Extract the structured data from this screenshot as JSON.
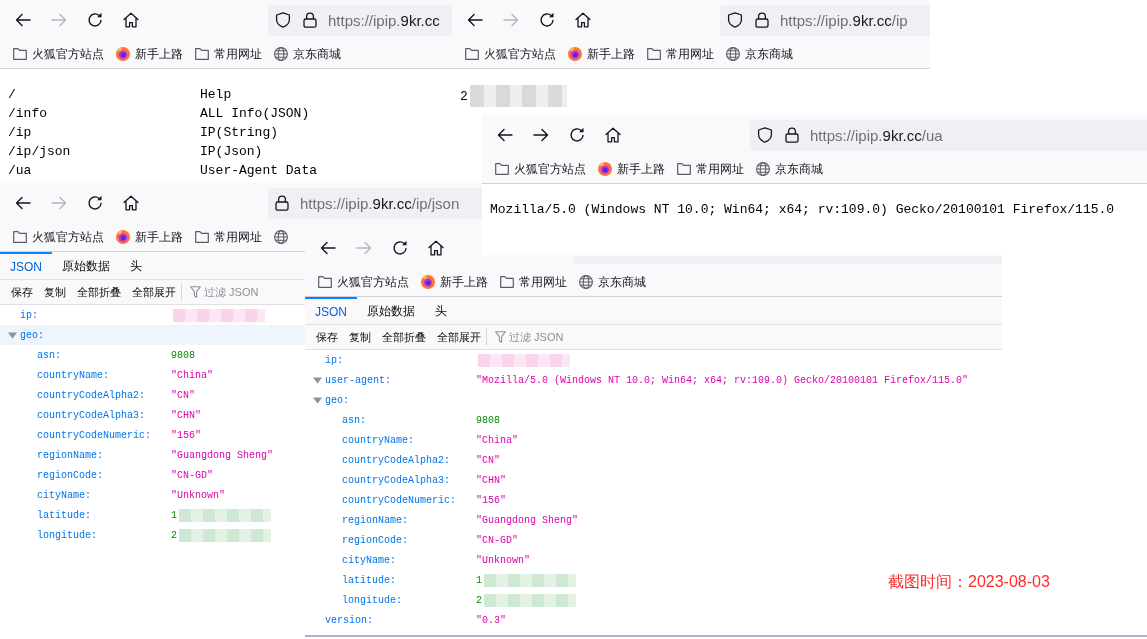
{
  "windows": [
    {
      "kind": "routes",
      "nav": {
        "forward_disabled": true
      },
      "url": {
        "origin": "https://ipip.",
        "domain": "9kr.cc",
        "shield": true
      },
      "bookmarks": [
        {
          "kind": "folder",
          "label": "火狐官方站点"
        },
        {
          "kind": "browser",
          "label": "新手上路"
        },
        {
          "kind": "folder",
          "label": "常用网址"
        },
        {
          "kind": "globe",
          "label": "京东商城"
        }
      ],
      "routes": [
        {
          "path": "/",
          "description": "Help"
        },
        {
          "path": "/info",
          "description": "ALL Info(JSON)"
        },
        {
          "path": "/ip",
          "description": "IP(String)"
        },
        {
          "path": "/ip/json",
          "description": "IP(Json)"
        },
        {
          "path": "/ua",
          "description": "User-Agent Data"
        }
      ]
    },
    {
      "kind": "text",
      "nav": {
        "forward_disabled": true
      },
      "url": {
        "origin": "https://ipip.",
        "domain": "9kr.cc",
        "path": "/ip",
        "shield": true
      },
      "bookmarks": [
        {
          "kind": "folder",
          "label": "火狐官方站点"
        },
        {
          "kind": "browser",
          "label": "新手上路"
        },
        {
          "kind": "folder",
          "label": "常用网址"
        },
        {
          "kind": "globe",
          "label": "京东商城"
        }
      ],
      "text": "2",
      "redacted": true
    },
    {
      "kind": "text",
      "nav": {
        "forward_disabled": false
      },
      "url": {
        "origin": "https://ipip.",
        "domain": "9kr.cc",
        "path": "/ua",
        "shield": true
      },
      "bookmarks": [
        {
          "kind": "folder",
          "label": "火狐官方站点"
        },
        {
          "kind": "browser",
          "label": "新手上路"
        },
        {
          "kind": "folder",
          "label": "常用网址"
        },
        {
          "kind": "globe",
          "label": "京东商城"
        }
      ],
      "text": "Mozilla/5.0 (Windows NT 10.0; Win64; x64; rv:109.0) Gecko/20100101 Firefox/115.0"
    },
    {
      "kind": "json",
      "nav": {
        "forward_disabled": true
      },
      "url": {
        "origin": "https://ipip.",
        "domain": "9kr.cc",
        "path": "/ip/json"
      },
      "bookmarks": [
        {
          "kind": "folder",
          "label": "火狐官方站点"
        },
        {
          "kind": "browser",
          "label": "新手上路"
        },
        {
          "kind": "folder",
          "label": "常用网址"
        },
        {
          "kind": "globe"
        }
      ],
      "tabs": [
        {
          "label": "JSON",
          "selected": true
        },
        {
          "label": "原始数据",
          "selected": false
        },
        {
          "label": "头",
          "selected": false
        }
      ],
      "actions": [
        "保存",
        "复制",
        "全部折叠",
        "全部展开"
      ],
      "filter": {
        "placeholder": "过滤 JSON"
      },
      "rows": [
        {
          "kind": "leaf",
          "key": "ip:",
          "value": {
            "kind": "string",
            "redacted": true
          },
          "selected": false
        },
        {
          "kind": "node",
          "key": "geo:",
          "expanded": true,
          "selected": true,
          "children": [
            {
              "kind": "leaf",
              "key": "asn:",
              "value": {
                "kind": "number",
                "text": "9808"
              },
              "selected": false
            },
            {
              "kind": "leaf",
              "key": "countryName:",
              "value": {
                "kind": "string",
                "text": "\"China\""
              },
              "selected": false
            },
            {
              "kind": "leaf",
              "key": "countryCodeAlpha2:",
              "value": {
                "kind": "string",
                "text": "\"CN\""
              },
              "selected": false
            },
            {
              "kind": "leaf",
              "key": "countryCodeAlpha3:",
              "value": {
                "kind": "string",
                "text": "\"CHN\""
              },
              "selected": false
            },
            {
              "kind": "leaf",
              "key": "countryCodeNumeric:",
              "value": {
                "kind": "string",
                "text": "\"156\""
              },
              "selected": false
            },
            {
              "kind": "leaf",
              "key": "regionName:",
              "value": {
                "kind": "string",
                "text": "\"Guangdong Sheng\""
              },
              "selected": false
            },
            {
              "kind": "leaf",
              "key": "regionCode:",
              "value": {
                "kind": "string",
                "text": "\"CN-GD\""
              },
              "selected": false
            },
            {
              "kind": "leaf",
              "key": "cityName:",
              "value": {
                "kind": "string",
                "text": "\"Unknown\""
              },
              "selected": false
            },
            {
              "kind": "leaf",
              "key": "latitude:",
              "value": {
                "kind": "number",
                "text": "1",
                "redacted": true
              },
              "selected": false
            },
            {
              "kind": "leaf",
              "key": "longitude:",
              "value": {
                "kind": "number",
                "text": "2",
                "redacted": true
              },
              "selected": false
            }
          ]
        }
      ]
    },
    {
      "kind": "json",
      "nav": {
        "forward_disabled": true
      },
      "bookmarks": [
        {
          "kind": "folder",
          "label": "火狐官方站点"
        },
        {
          "kind": "browser",
          "label": "新手上路"
        },
        {
          "kind": "folder",
          "label": "常用网址"
        },
        {
          "kind": "globe",
          "label": "京东商城"
        }
      ],
      "tabs": [
        {
          "label": "JSON",
          "selected": true
        },
        {
          "label": "原始数据",
          "selected": false
        },
        {
          "label": "头",
          "selected": false
        }
      ],
      "actions": [
        "保存",
        "复制",
        "全部折叠",
        "全部展开"
      ],
      "filter": {
        "placeholder": "过滤 JSON"
      },
      "rows": [
        {
          "kind": "leaf",
          "key": "ip:",
          "value": {
            "kind": "string",
            "redacted": true
          },
          "selected": false
        },
        {
          "kind": "node",
          "key": "user-agent:",
          "value": {
            "kind": "string",
            "text": "\"Mozilla/5.0 (Windows NT 10.0; Win64; x64; rv:109.0) Gecko/20100101 Firefox/115.0\""
          },
          "expanded": true,
          "selected": false
        },
        {
          "kind": "node",
          "key": "geo:",
          "expanded": true,
          "selected": false,
          "children": [
            {
              "kind": "leaf",
              "key": "asn:",
              "value": {
                "kind": "number",
                "text": "9808"
              },
              "selected": false
            },
            {
              "kind": "leaf",
              "key": "countryName:",
              "value": {
                "kind": "string",
                "text": "\"China\""
              },
              "selected": false
            },
            {
              "kind": "leaf",
              "key": "countryCodeAlpha2:",
              "value": {
                "kind": "string",
                "text": "\"CN\""
              },
              "selected": false
            },
            {
              "kind": "leaf",
              "key": "countryCodeAlpha3:",
              "value": {
                "kind": "string",
                "text": "\"CHN\""
              },
              "selected": false
            },
            {
              "kind": "leaf",
              "key": "countryCodeNumeric:",
              "value": {
                "kind": "string",
                "text": "\"156\""
              },
              "selected": false
            },
            {
              "kind": "leaf",
              "key": "regionName:",
              "value": {
                "kind": "string",
                "text": "\"Guangdong Sheng\""
              },
              "selected": false
            },
            {
              "kind": "leaf",
              "key": "regionCode:",
              "value": {
                "kind": "string",
                "text": "\"CN-GD\""
              },
              "selected": false
            },
            {
              "kind": "leaf",
              "key": "cityName:",
              "value": {
                "kind": "string",
                "text": "\"Unknown\""
              },
              "selected": false
            },
            {
              "kind": "leaf",
              "key": "latitude:",
              "value": {
                "kind": "number",
                "text": "1",
                "redacted": true
              },
              "selected": false
            },
            {
              "kind": "leaf",
              "key": "longitude:",
              "value": {
                "kind": "number",
                "text": "2",
                "redacted": true
              },
              "selected": false
            }
          ]
        },
        {
          "kind": "leaf",
          "key": "version:",
          "value": {
            "kind": "string",
            "text": "\"0.3\""
          },
          "selected": false
        }
      ]
    }
  ],
  "caption": "截图时间：2023-08-03"
}
